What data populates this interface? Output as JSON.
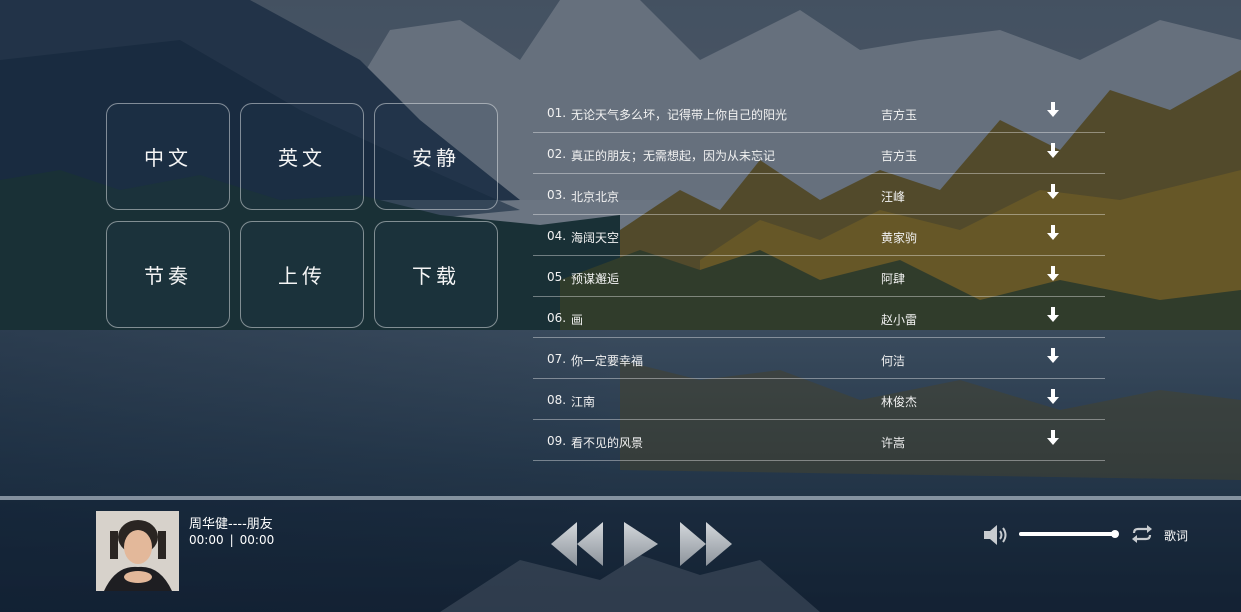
{
  "categories": [
    {
      "label": "中文"
    },
    {
      "label": "英文"
    },
    {
      "label": "安静"
    },
    {
      "label": "节奏"
    },
    {
      "label": "上传"
    },
    {
      "label": "下载"
    }
  ],
  "songs": [
    {
      "num": "01.",
      "title": "无论天气多么坏，记得带上你自己的阳光",
      "artist": "吉方玉"
    },
    {
      "num": "02.",
      "title": "真正的朋友；无需想起，因为从未忘记",
      "artist": "吉方玉"
    },
    {
      "num": "03.",
      "title": "北京北京",
      "artist": "汪峰"
    },
    {
      "num": "04.",
      "title": "海阔天空",
      "artist": "黄家驹"
    },
    {
      "num": "05.",
      "title": "预谋邂逅",
      "artist": "阿肆"
    },
    {
      "num": "06.",
      "title": "画",
      "artist": "赵小雷"
    },
    {
      "num": "07.",
      "title": "你一定要幸福",
      "artist": "何洁"
    },
    {
      "num": "08.",
      "title": "江南",
      "artist": "林俊杰"
    },
    {
      "num": "09.",
      "title": "看不见的风景",
      "artist": "许嵩"
    }
  ],
  "icons": {
    "download": "download-arrow-icon",
    "prev": "previous-track-icon",
    "play": "play-icon",
    "next": "next-track-icon",
    "volume": "speaker-icon",
    "loop": "repeat-icon"
  },
  "player": {
    "track": "周华健----朋友",
    "current_time": "00:00",
    "separator": "|",
    "duration": "00:00",
    "volume_level": 0.98,
    "lyrics_label": "歌词"
  },
  "colors": {
    "text": "#ffffff",
    "control_gray": "#b8bec6",
    "divider": "rgba(255,255,255,0.38)"
  }
}
